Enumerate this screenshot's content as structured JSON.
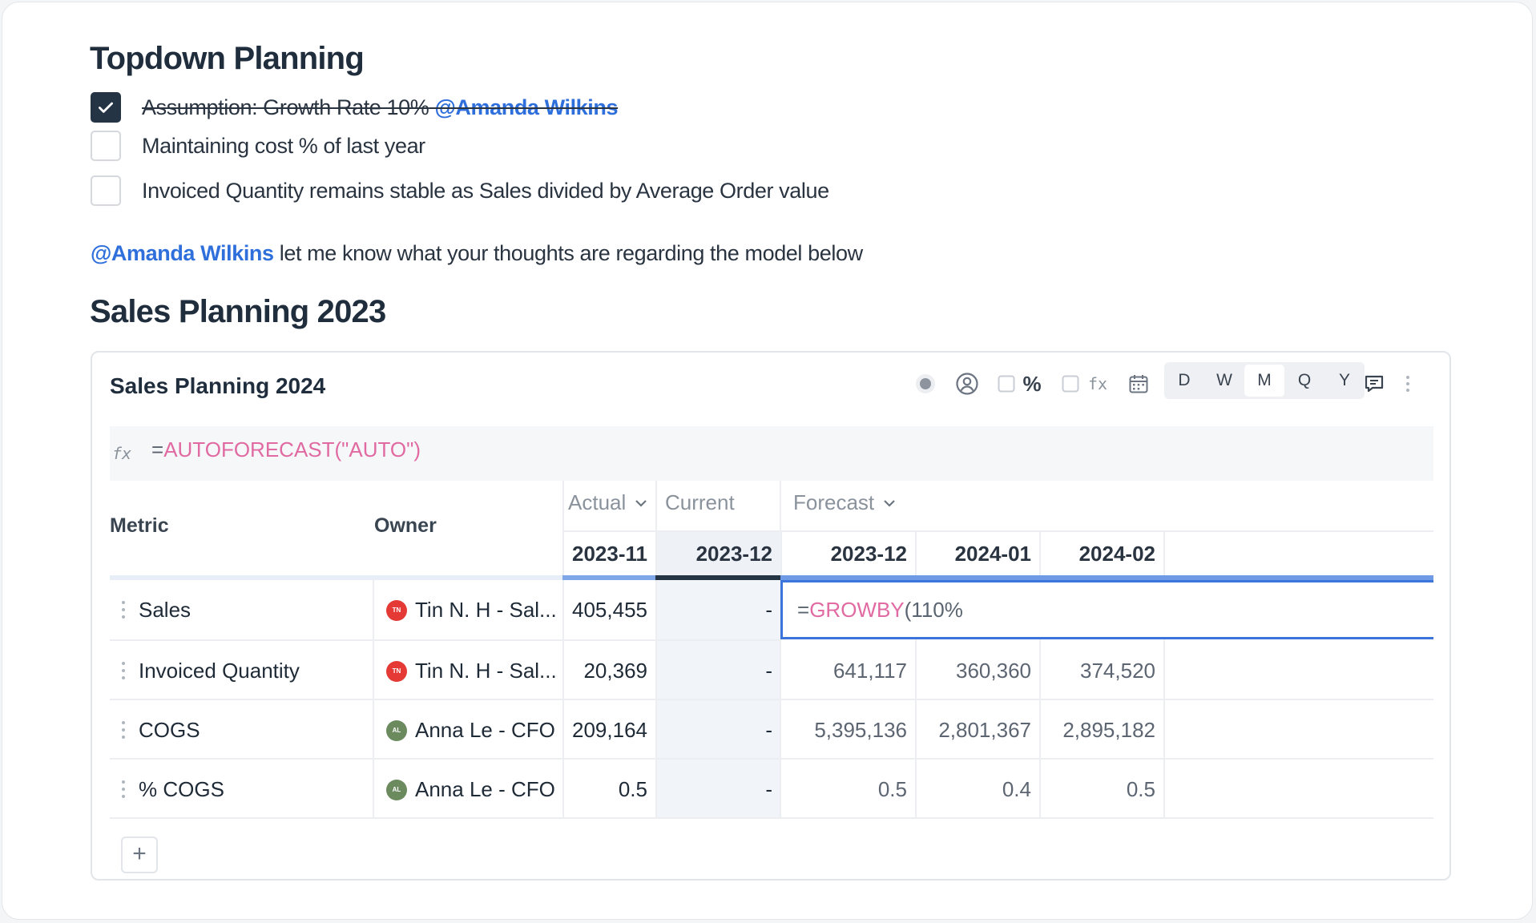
{
  "heading1": "Topdown Planning",
  "todos": [
    {
      "text": "Assumption: Growth Rate 10%",
      "mention": "@Amanda Wilkins",
      "checked": true
    },
    {
      "text": "Maintaining cost % of last year",
      "mention": "",
      "checked": false
    },
    {
      "text": "Invoiced Quantity remains stable as Sales divided by Average Order value",
      "mention": "",
      "checked": false
    }
  ],
  "note": {
    "mention": "@Amanda Wilkins",
    "text": " let me know what your thoughts are regarding the model below"
  },
  "heading2": "Sales Planning 2023",
  "card": {
    "title": "Sales Planning 2024",
    "toolbar": {
      "icons": [
        "record-icon",
        "user-circle-icon",
        "checkbox-icon",
        "percent-icon",
        "checkbox-icon",
        "fx-icon",
        "calendar-icon",
        "comment-icon",
        "more-vertical-icon"
      ],
      "percent_label": "%",
      "fx_label": "fx",
      "periods": [
        "D",
        "W",
        "M",
        "Q",
        "Y"
      ],
      "active_period": "M"
    },
    "formula": {
      "fx_label": "fx",
      "prefix": "=",
      "fn": "AUTOFORECAST",
      "args": "(\"AUTO\")"
    },
    "columns": {
      "metric": "Metric",
      "owner": "Owner",
      "groups": {
        "actual": "Actual",
        "current": "Current",
        "forecast": "Forecast"
      },
      "periods": [
        "2023-11",
        "2023-12",
        "2023-12",
        "2024-01",
        "2024-02"
      ]
    },
    "rows": [
      {
        "metric": "Sales",
        "owner": "Tin N. H - Sal...",
        "initials": "TN",
        "avatar_color": "#e53935",
        "actual": "405,455",
        "current": "-",
        "forecast": [
          "",
          "",
          ""
        ],
        "edit": {
          "prefix": "=",
          "fn": "GROWBY",
          "args": "(110%"
        }
      },
      {
        "metric": "Invoiced Quantity",
        "owner": "Tin N. H - Sal...",
        "initials": "TN",
        "avatar_color": "#e53935",
        "actual": "20,369",
        "current": "-",
        "forecast": [
          "641,117",
          "360,360",
          "374,520"
        ]
      },
      {
        "metric": "COGS",
        "owner": "Anna Le - CFO",
        "initials": "AL",
        "avatar_color": "#6b8a5e",
        "actual": "209,164",
        "current": "-",
        "forecast": [
          "5,395,136",
          "2,801,367",
          "2,895,182"
        ]
      },
      {
        "metric": "% COGS",
        "owner": "Anna Le - CFO",
        "initials": "AL",
        "avatar_color": "#6b8a5e",
        "actual": "0.5",
        "current": "-",
        "forecast": [
          "0.5",
          "0.4",
          "0.5"
        ]
      }
    ],
    "add_label": "+"
  }
}
